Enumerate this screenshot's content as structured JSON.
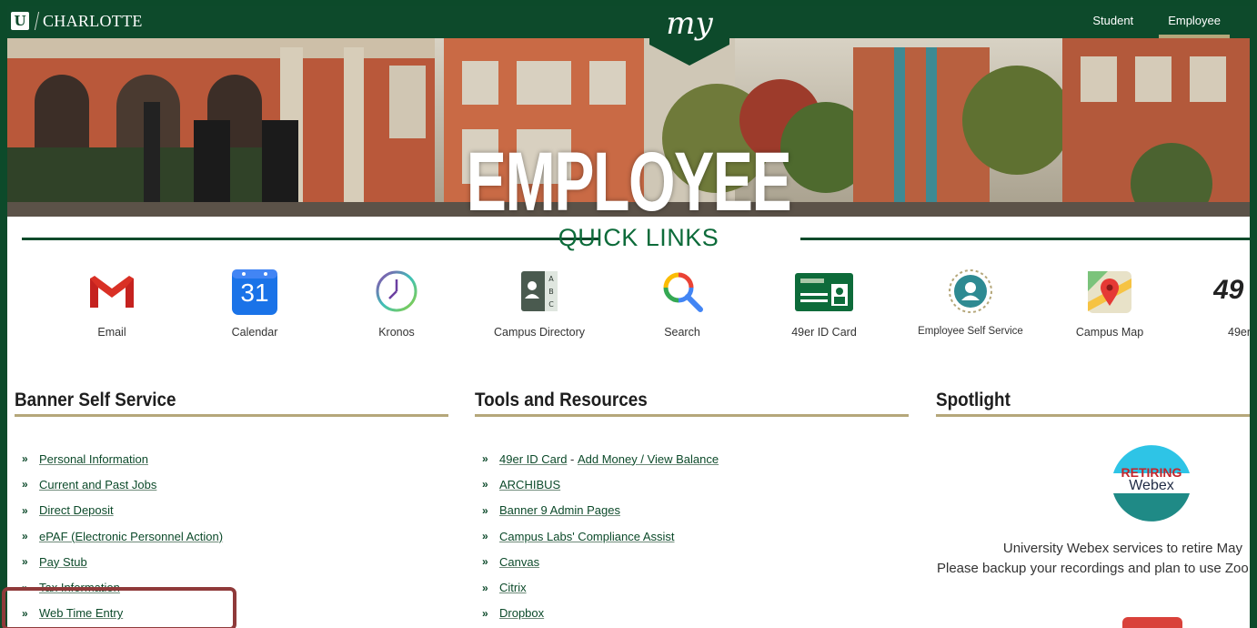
{
  "header": {
    "brand_logo": "U",
    "brand_name": "CHARLOTTE",
    "my_label": "my",
    "tabs": [
      {
        "label": "Student",
        "active": false
      },
      {
        "label": "Employee",
        "active": true
      }
    ]
  },
  "hero": {
    "title": "EMPLOYEE"
  },
  "quick_links": {
    "title": "QUICK LINKS",
    "items": [
      {
        "label": "Email",
        "icon": "gmail-icon"
      },
      {
        "label": "Calendar",
        "icon": "calendar-icon",
        "icon_text": "31"
      },
      {
        "label": "Kronos",
        "icon": "clock-icon"
      },
      {
        "label": "Campus Directory",
        "icon": "directory-icon"
      },
      {
        "label": "Search",
        "icon": "search-icon"
      },
      {
        "label": "49er ID Card",
        "icon": "id-card-icon"
      },
      {
        "label": "Employee Self Service",
        "icon": "employee-self-service-icon"
      },
      {
        "label": "Campus Map",
        "icon": "map-pin-icon"
      },
      {
        "label": "49er",
        "icon": "niner-logo-icon",
        "icon_text": "49"
      }
    ]
  },
  "banner_self_service": {
    "title": "Banner Self Service",
    "links": [
      {
        "label": "Personal Information"
      },
      {
        "label": "Current and Past Jobs"
      },
      {
        "label": "Direct Deposit"
      },
      {
        "label": "ePAF (Electronic Personnel Action)"
      },
      {
        "label": "Pay Stub"
      },
      {
        "label": "Tax Information"
      },
      {
        "label": "Web Time Entry"
      }
    ]
  },
  "tools_resources": {
    "title": "Tools and Resources",
    "links": [
      {
        "label": "49er ID Card",
        "separator": " - ",
        "label2": "Add Money / View Balance"
      },
      {
        "label": "ARCHIBUS"
      },
      {
        "label": "Banner 9 Admin Pages"
      },
      {
        "label": "Campus Labs' Compliance Assist"
      },
      {
        "label": "Canvas"
      },
      {
        "label": "Citrix"
      },
      {
        "label": "Dropbox"
      }
    ]
  },
  "spotlight": {
    "title": "Spotlight",
    "logo_line1": "RETIRING",
    "logo_line2": "Webex",
    "line1": "University Webex services to retire May",
    "line2": "Please backup your recordings and plan to use Zoo"
  },
  "colors": {
    "brand_green": "#0d4a2b",
    "accent_gold": "#b5a77a",
    "quick_links_green": "#0d6b3a",
    "highlight": "#8f3a3a"
  }
}
